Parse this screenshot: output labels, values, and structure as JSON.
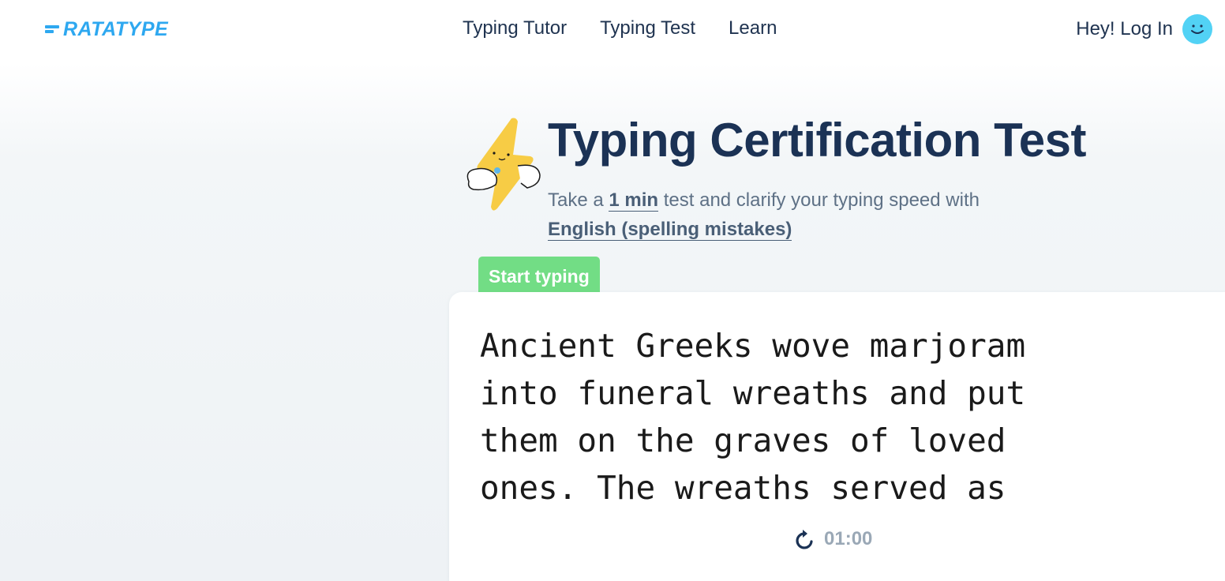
{
  "header": {
    "logo_text": "RATATYPE",
    "nav": [
      {
        "label": "Typing Tutor"
      },
      {
        "label": "Typing Test"
      },
      {
        "label": "Learn"
      }
    ],
    "login_label": "Hey! Log In"
  },
  "hero": {
    "title": "Typing Certification Test",
    "subtitle_prefix": "Take a ",
    "duration": "1 min",
    "subtitle_middle": " test and clarify your typing speed with",
    "language": "English (spelling mistakes)"
  },
  "test": {
    "start_label": "Start typing",
    "lines": [
      "Ancient Greeks wove marjoram",
      "into funeral wreaths and put",
      "them on the graves of loved",
      "ones. The wreaths served as"
    ],
    "timer": "01:00"
  },
  "colors": {
    "brand": "#2ea8f0",
    "heading": "#1b3255",
    "start_tag": "#72dd85",
    "avatar": "#52d2f5"
  },
  "icons": {
    "mascot": "lightning-mascot-icon",
    "restart": "restart-icon",
    "avatar": "smiley-avatar-icon"
  }
}
